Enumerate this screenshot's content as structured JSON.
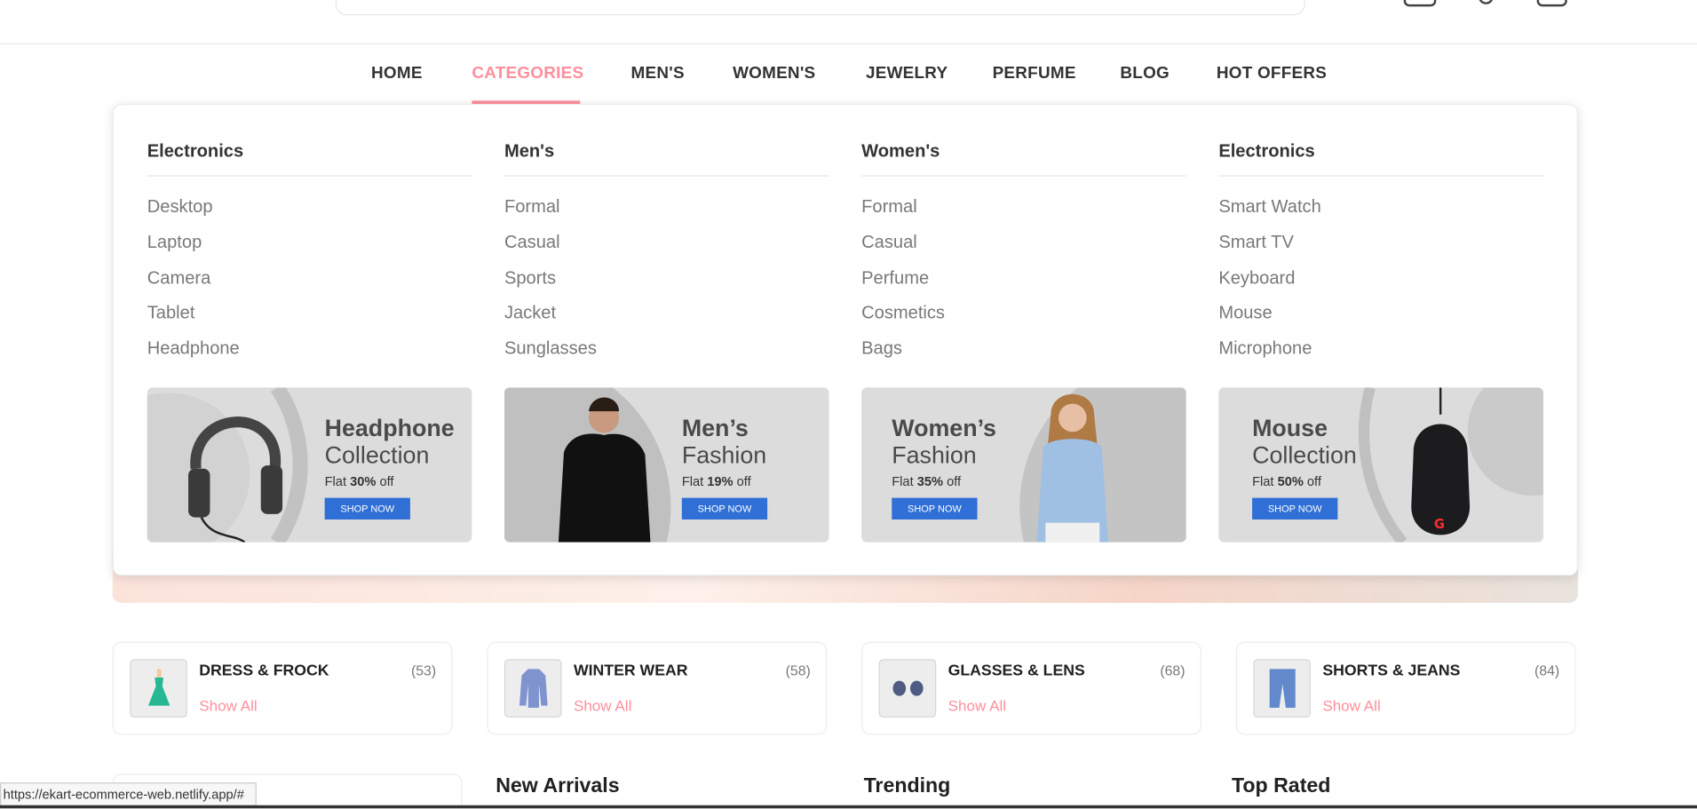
{
  "nav": {
    "items": [
      "HOME",
      "CATEGORIES",
      "MEN'S",
      "WOMEN'S",
      "JEWELRY",
      "PERFUME",
      "BLOG",
      "HOT OFFERS"
    ],
    "active": "CATEGORIES"
  },
  "mega_menu": {
    "columns": [
      {
        "heading": "Electronics",
        "items": [
          "Desktop",
          "Laptop",
          "Camera",
          "Tablet",
          "Headphone"
        ]
      },
      {
        "heading": "Men's",
        "items": [
          "Formal",
          "Casual",
          "Sports",
          "Jacket",
          "Sunglasses"
        ]
      },
      {
        "heading": "Women's",
        "items": [
          "Formal",
          "Casual",
          "Perfume",
          "Cosmetics",
          "Bags"
        ]
      },
      {
        "heading": "Electronics",
        "items": [
          "Smart Watch",
          "Smart TV",
          "Keyboard",
          "Mouse",
          "Microphone"
        ]
      }
    ],
    "banners": [
      {
        "title": "Headphone",
        "subtitle": "Collection",
        "flat": "Flat",
        "discount": "30%",
        "off": "off",
        "button": "SHOP NOW"
      },
      {
        "title": "Men’s",
        "subtitle": "Fashion",
        "flat": "Flat",
        "discount": "19%",
        "off": "off",
        "button": "SHOP NOW"
      },
      {
        "title": "Women’s",
        "subtitle": "Fashion",
        "flat": "Flat",
        "discount": "35%",
        "off": "off",
        "button": "SHOP NOW"
      },
      {
        "title": "Mouse",
        "subtitle": "Collection",
        "flat": "Flat",
        "discount": "50%",
        "off": "off",
        "button": "SHOP NOW"
      }
    ]
  },
  "categories": [
    {
      "title": "DRESS & FROCK",
      "count": "(53)",
      "link": "Show All",
      "icon": "dress-icon"
    },
    {
      "title": "WINTER WEAR",
      "count": "(58)",
      "link": "Show All",
      "icon": "coat-icon"
    },
    {
      "title": "GLASSES & LENS",
      "count": "(68)",
      "link": "Show All",
      "icon": "glasses-icon"
    },
    {
      "title": "SHORTS & JEANS",
      "count": "(84)",
      "link": "Show All",
      "icon": "jeans-icon"
    }
  ],
  "sections": [
    "New Arrivals",
    "Trending",
    "Top Rated"
  ],
  "status_url": "https://ekart-ecommerce-web.netlify.app/#",
  "colors": {
    "accent": "#ff8f9c",
    "button": "#2f6fd6",
    "text": "#333333"
  }
}
